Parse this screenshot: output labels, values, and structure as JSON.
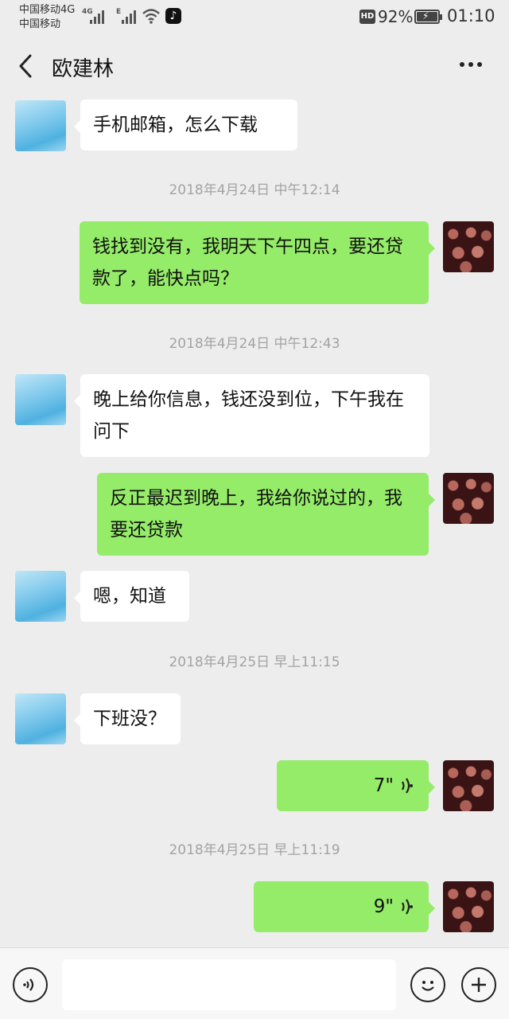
{
  "status_bar": {
    "carrier1": "中国移动4G",
    "carrier2": "中国移动",
    "net1": "4G",
    "net2": "E",
    "hd": "HD",
    "battery_pct": "92%",
    "battery_level": 0.92,
    "time": "01:10"
  },
  "header": {
    "title": "欧建林",
    "back_icon": "back-chevron-icon",
    "more_icon": "more-dots-icon"
  },
  "messages": [
    {
      "side": "left",
      "type": "text",
      "text": "手机邮箱，怎么下载"
    },
    {
      "type": "timestamp",
      "text": "2018年4月24日 中午12:14"
    },
    {
      "side": "right",
      "type": "text",
      "text": "钱找到没有，我明天下午四点，要还贷款了，能快点吗？"
    },
    {
      "type": "timestamp",
      "text": "2018年4月24日 中午12:43"
    },
    {
      "side": "left",
      "type": "text",
      "text": "晚上给你信息，钱还没到位，下午我在问下"
    },
    {
      "side": "right",
      "type": "text",
      "text": "反正最迟到晚上，我给你说过的，我要还贷款"
    },
    {
      "side": "left",
      "type": "text",
      "text": "嗯，知道"
    },
    {
      "type": "timestamp",
      "text": "2018年4月25日 早上11:15"
    },
    {
      "side": "left",
      "type": "text",
      "text": "下班没？"
    },
    {
      "side": "right",
      "type": "voice",
      "text": "7\""
    },
    {
      "type": "timestamp",
      "text": "2018年4月25日 早上11:19"
    },
    {
      "side": "right",
      "type": "voice",
      "text": "9\""
    }
  ],
  "input_bar": {
    "voice_icon": "voice-mode-icon",
    "emoji_icon": "emoji-icon",
    "plus_icon": "plus-icon"
  },
  "colors": {
    "background": "#ededed",
    "bubble_mine": "#95ec69",
    "bubble_other": "#ffffff",
    "timestamp": "#a3a3a3"
  }
}
